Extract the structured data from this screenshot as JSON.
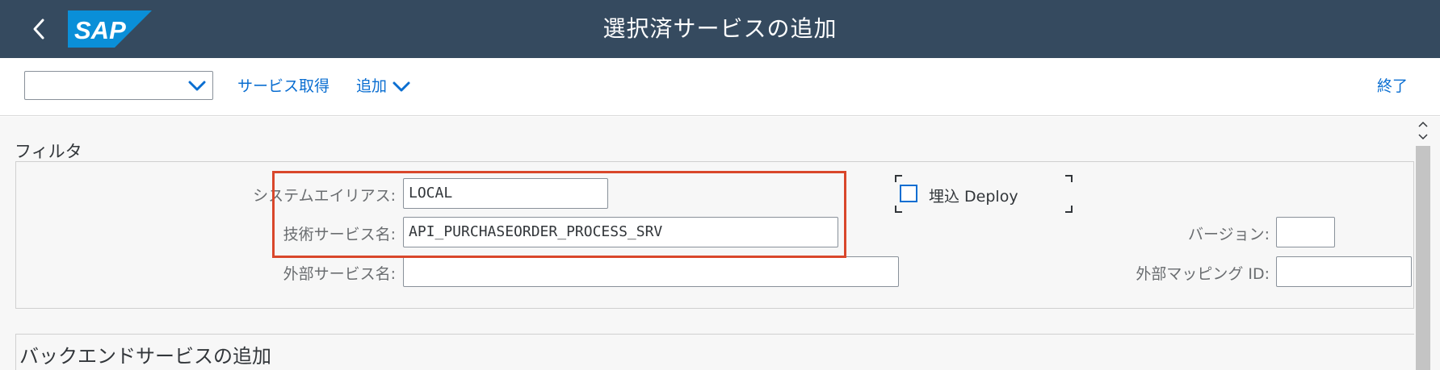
{
  "shell": {
    "title": "選択済サービスの追加",
    "logo_text": "SAP",
    "brand_color": "#354a5f",
    "logo_color": "#0a8fd8",
    "back_icon": "chevron-left-icon"
  },
  "toolbar": {
    "command_select_value": "",
    "get_services_label": "サービス取得",
    "add_label": "追加",
    "exit_label": "終了",
    "accent_color": "#0a6ed1"
  },
  "filter": {
    "title": "フィルタ",
    "system_alias": {
      "label": "システムエイリアス:",
      "value": "LOCAL"
    },
    "technical_service_name": {
      "label": "技術サービス名:",
      "value": "API_PURCHASEORDER_PROCESS_SRV"
    },
    "external_service_name": {
      "label": "外部サービス名:",
      "value": ""
    },
    "embed_deploy": {
      "label": "埋込 Deploy",
      "checked": false
    },
    "version": {
      "label": "バージョン:",
      "value": ""
    },
    "external_mapping_id": {
      "label": "外部マッピング ID:",
      "value": ""
    },
    "highlight_color": "#d9472b"
  },
  "backend": {
    "title": "バックエンドサービスの追加"
  }
}
